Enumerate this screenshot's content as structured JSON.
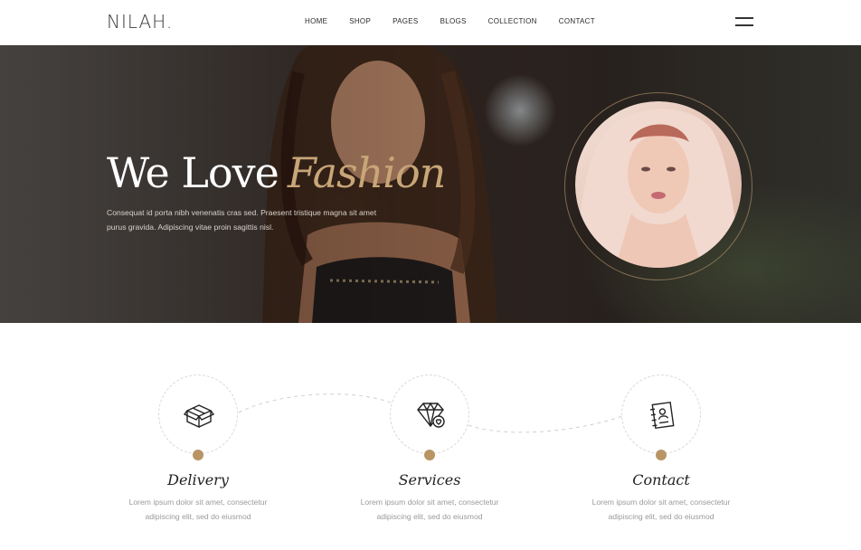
{
  "header": {
    "logo": "NILAH.",
    "nav": [
      "HOME",
      "SHOP",
      "PAGES",
      "BLOGS",
      "COLLECTION",
      "CONTACT"
    ],
    "menu_icon": "hamburger-menu-icon"
  },
  "hero": {
    "title_plain": "We Love",
    "title_accent": "Fashion",
    "subtitle_line1": "Consequat id porta nibh venenatis cras sed. Praesent tristique magna sit amet",
    "subtitle_line2": "purus gravida. Adipiscing vitae proin sagittis nisl.",
    "accent_color": "#c8a678"
  },
  "features": [
    {
      "icon": "box-icon",
      "title": "Delivery",
      "text_line1": "Lorem ipsum dolor sit amet, consectetur",
      "text_line2": "adipiscing elit, sed do eiusmod"
    },
    {
      "icon": "diamond-icon",
      "title": "Services",
      "text_line1": "Lorem ipsum dolor sit amet, consectetur",
      "text_line2": "adipiscing elit, sed do eiusmod"
    },
    {
      "icon": "contact-book-icon",
      "title": "Contact",
      "text_line1": "Lorem ipsum dolor sit amet, consectetur",
      "text_line2": "adipiscing elit, sed do eiusmod"
    }
  ],
  "colors": {
    "accent": "#b99464",
    "text": "#222222",
    "muted": "#9a9a9a"
  }
}
